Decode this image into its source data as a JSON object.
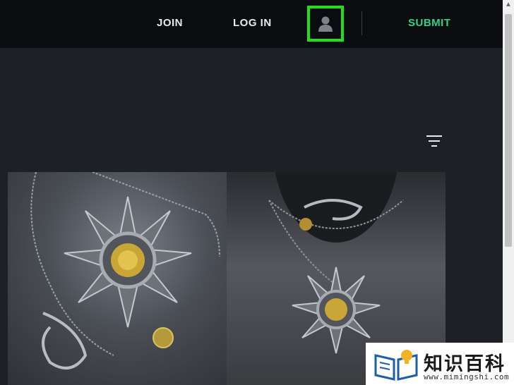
{
  "nav": {
    "join_label": "JOIN",
    "login_label": "LOG IN",
    "submit_label": "SUBMIT",
    "avatar_icon": "user-avatar-icon",
    "highlight_color": "#20e018",
    "submit_color": "#2ed389"
  },
  "toolbar": {
    "filter_icon": "filter-lines-icon"
  },
  "gallery": {
    "items": [
      {
        "description_icon": "sun-pendant-necklace-photo"
      },
      {
        "description_icon": "sun-pendant-on-mannequin-photo"
      }
    ]
  },
  "watermark": {
    "title": "知识百科",
    "url": "www.mimingshi.com"
  }
}
